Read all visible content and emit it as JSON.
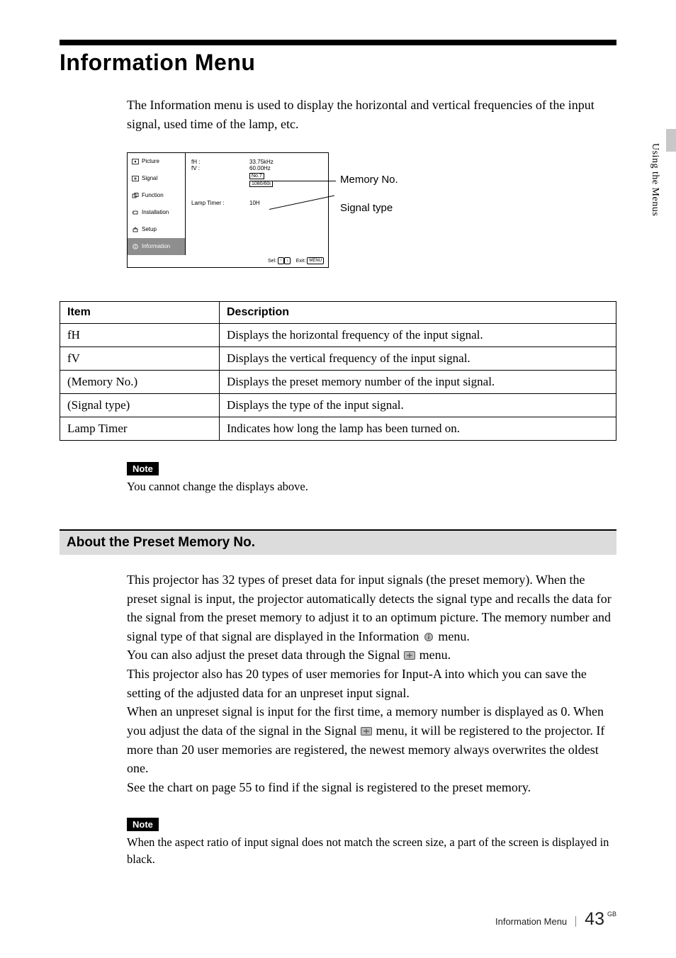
{
  "side_tab": "Using the Menus",
  "title": "Information Menu",
  "intro": "The Information menu is used to display the horizontal and vertical frequencies of the input signal, used time of the lamp, etc.",
  "osd": {
    "left": [
      "Picture",
      "Signal",
      "Function",
      "Installation",
      "Setup",
      "Information"
    ],
    "rows": {
      "fH_label": "fH :",
      "fH_value": "33.75kHz",
      "fV_label": "fV :",
      "fV_value": "60.00Hz",
      "memno": "No.7",
      "sigtype": "1080/60i",
      "lamp_label": "Lamp Timer :",
      "lamp_value": "10H"
    },
    "footer_sel": "Sel:",
    "footer_exit": "Exit:",
    "footer_menu": "MENU"
  },
  "callouts": {
    "memory": "Memory No.",
    "signal": "Signal type"
  },
  "table": {
    "head_item": "Item",
    "head_desc": "Description",
    "rows": [
      {
        "item": "fH",
        "desc": "Displays the horizontal frequency of the input signal."
      },
      {
        "item": "fV",
        "desc": "Displays the vertical frequency of the input signal."
      },
      {
        "item": "(Memory No.)",
        "desc": "Displays the preset memory number of the input signal."
      },
      {
        "item": "(Signal type)",
        "desc": "Displays the type of the input signal."
      },
      {
        "item": "Lamp Timer",
        "desc": "Indicates how long the lamp has been turned on."
      }
    ]
  },
  "note1_label": "Note",
  "note1_text": "You cannot change the displays above.",
  "subhead": "About the Preset Memory No.",
  "body": {
    "p1a": "This projector has 32 types of preset data for input signals (the preset memory). When the preset signal is input, the projector automatically detects the signal type and recalls the data for the signal from the preset memory to adjust it to an optimum picture. The memory number and signal type of that signal are displayed in the Information ",
    "p1b": " menu.",
    "p2a": "You can also adjust the preset data through the Signal ",
    "p2b": " menu.",
    "p3": "This projector also has 20 types of user memories for Input-A into which you can save the setting of the adjusted data for an unpreset input signal.",
    "p4a": "When an unpreset signal is input for the first time, a memory number is displayed as 0. When you adjust the data of the signal in the Signal ",
    "p4b": " menu, it will be registered to the projector. If more than 20 user memories are registered, the newest memory always overwrites the oldest one.",
    "p5": "See the chart on page 55 to find if the signal is registered to the preset memory."
  },
  "note2_label": "Note",
  "note2_text": "When the aspect ratio of input signal does not match the screen size, a part of the screen is displayed in black.",
  "footer": {
    "title": "Information Menu",
    "page": "43",
    "gb": "GB"
  }
}
